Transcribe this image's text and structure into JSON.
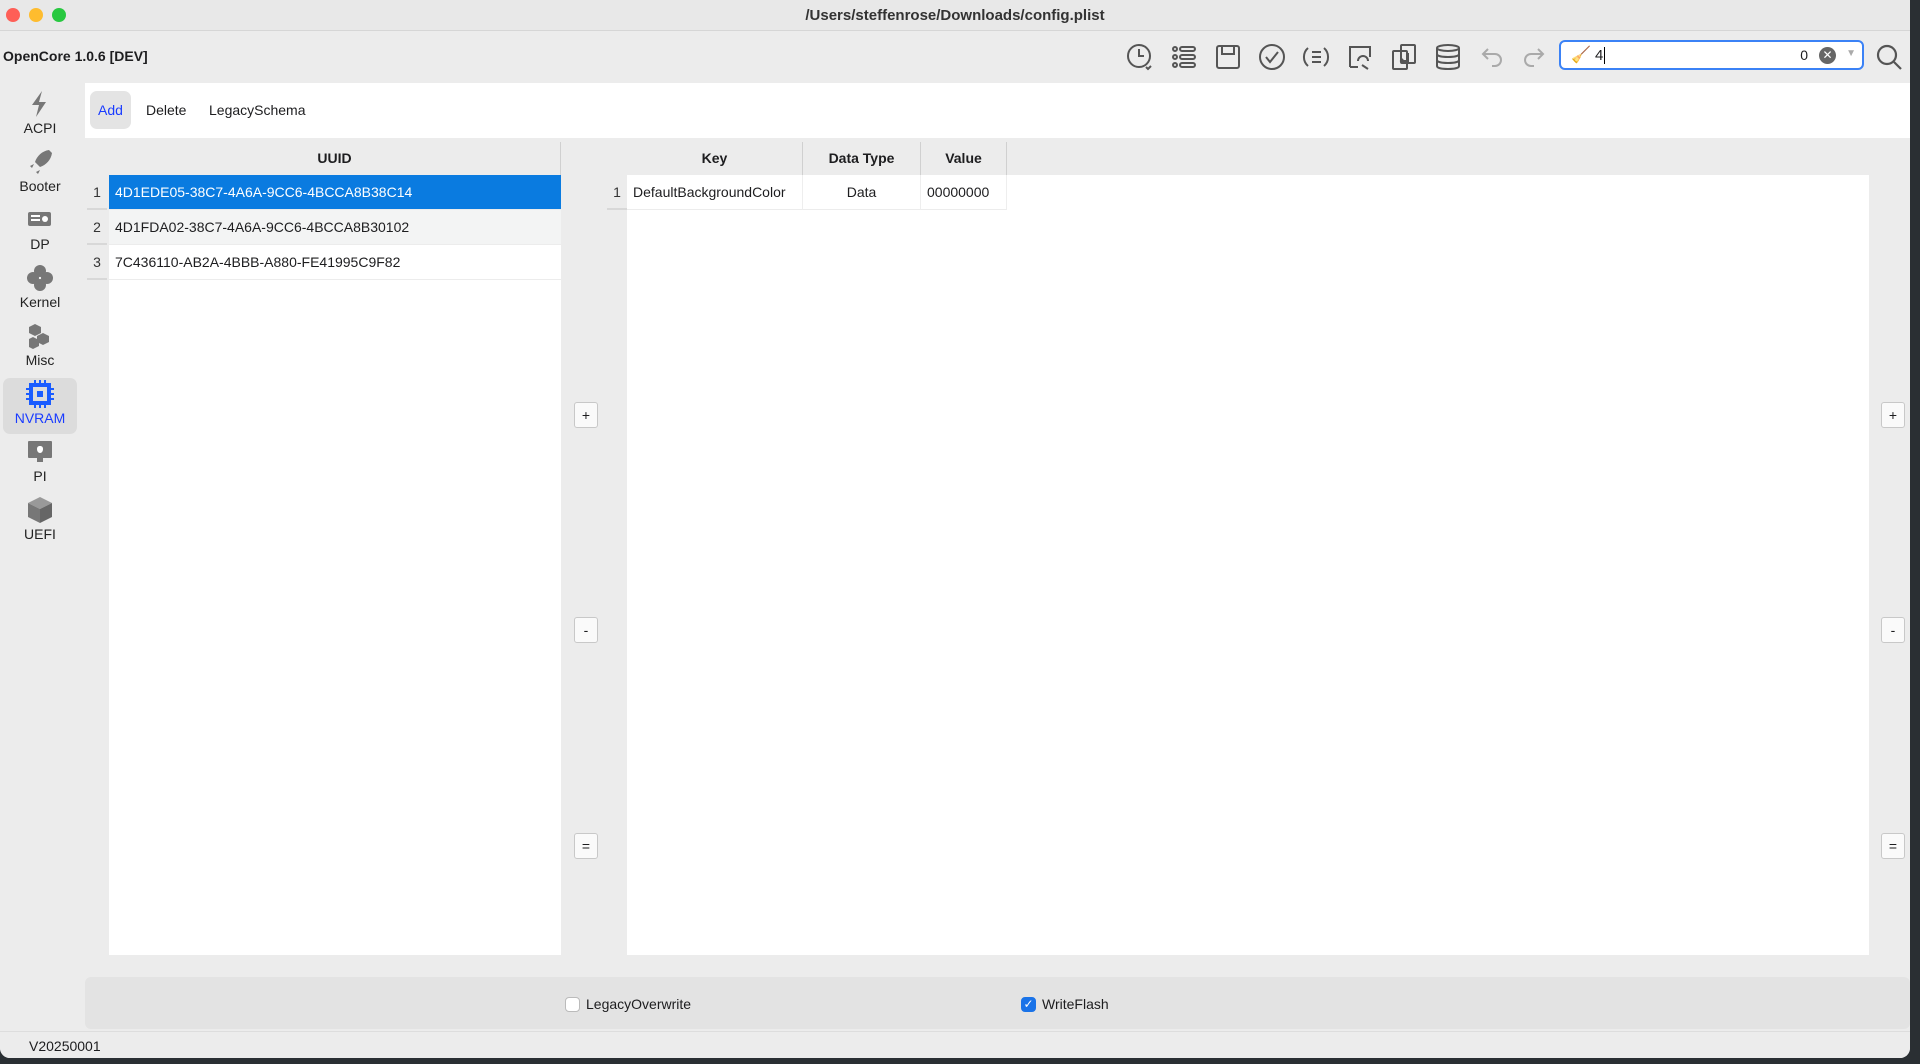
{
  "window": {
    "title": "/Users/steffenrose/Downloads/config.plist"
  },
  "toolbar": {
    "app_title": "OpenCore 1.0.6 [DEV]",
    "icons": [
      "clock-icon",
      "list-icon",
      "save-icon",
      "check-icon",
      "list-cycle-icon",
      "edit-link-icon",
      "copy-icon",
      "database-icon",
      "undo-icon",
      "redo-icon"
    ],
    "search": {
      "value": "4",
      "count": "0"
    }
  },
  "sidebar": {
    "items": [
      {
        "label": "ACPI",
        "icon": "bolt-icon"
      },
      {
        "label": "Booter",
        "icon": "rocket-icon"
      },
      {
        "label": "DP",
        "icon": "graphics-card-icon"
      },
      {
        "label": "Kernel",
        "icon": "kernel-icon"
      },
      {
        "label": "Misc",
        "icon": "cubes-icon"
      },
      {
        "label": "NVRAM",
        "icon": "chip-icon",
        "active": true
      },
      {
        "label": "PI",
        "icon": "apple-monitor-icon"
      },
      {
        "label": "UEFI",
        "icon": "box-icon"
      }
    ]
  },
  "tabs": [
    {
      "label": "Add",
      "active": true
    },
    {
      "label": "Delete"
    },
    {
      "label": "LegacySchema"
    }
  ],
  "uuid_table": {
    "header": "UUID",
    "rows": [
      {
        "num": "1",
        "uuid": "4D1EDE05-38C7-4A6A-9CC6-4BCCA8B38C14"
      },
      {
        "num": "2",
        "uuid": "4D1FDA02-38C7-4A6A-9CC6-4BCCA8B30102"
      },
      {
        "num": "3",
        "uuid": "7C436110-AB2A-4BBB-A880-FE41995C9F82"
      }
    ]
  },
  "kv_table": {
    "headers": [
      "Key",
      "Data Type",
      "Value"
    ],
    "rows": [
      {
        "num": "1",
        "key": "DefaultBackgroundColor",
        "type": "Data",
        "value": "00000000"
      }
    ]
  },
  "side_buttons": {
    "add": "+",
    "remove": "-",
    "copy": "="
  },
  "options": {
    "legacy_overwrite": {
      "label": "LegacyOverwrite",
      "checked": false
    },
    "write_flash": {
      "label": "WriteFlash",
      "checked": true
    }
  },
  "status": {
    "version": "V20250001"
  },
  "colors": {
    "accent": "#0a7be0",
    "active_text": "#1a3cff"
  }
}
